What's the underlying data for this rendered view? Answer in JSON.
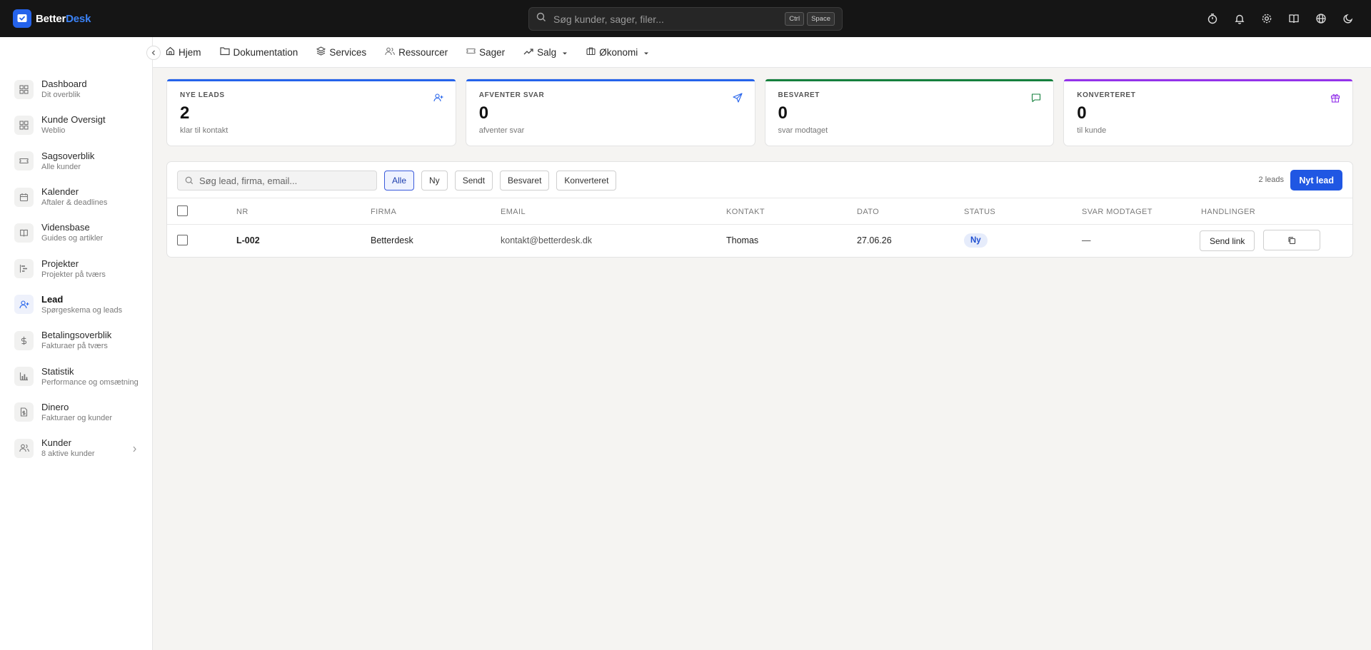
{
  "app": {
    "logo_text_a": "Better",
    "logo_text_b": "Desk",
    "accent_color": "#2563eb"
  },
  "search": {
    "placeholder": "Søg kunder, sager, filer...",
    "shortcut_keys": [
      "Ctrl",
      "Space"
    ]
  },
  "top_icons": [
    "timer-icon",
    "bell-icon",
    "gear-icon",
    "book-icon",
    "globe-icon",
    "moon-icon"
  ],
  "sidebar": {
    "items": [
      {
        "title": "Dashboard",
        "sub": "Dit overblik",
        "icon": "grid-icon"
      },
      {
        "title": "Kunde Oversigt",
        "sub": "Weblio",
        "icon": "grid-icon"
      },
      {
        "title": "Sagsoverblik",
        "sub": "Alle kunder",
        "icon": "ticket-icon"
      },
      {
        "title": "Kalender",
        "sub": "Aftaler & deadlines",
        "icon": "calendar-icon"
      },
      {
        "title": "Vidensbase",
        "sub": "Guides og artikler",
        "icon": "book-icon"
      },
      {
        "title": "Projekter",
        "sub": "Projekter på tværs",
        "icon": "gantt-icon"
      },
      {
        "title": "Lead",
        "sub": "Spørgeskema og leads",
        "icon": "user-plus-icon",
        "active": true
      },
      {
        "title": "Betalingsoverblik",
        "sub": "Fakturaer på tværs",
        "icon": "dollar-icon"
      },
      {
        "title": "Statistik",
        "sub": "Performance og omsætning",
        "icon": "bar-chart-icon"
      },
      {
        "title": "Dinero",
        "sub": "Fakturaer og kunder",
        "icon": "file-dollar-icon"
      },
      {
        "title": "Kunder",
        "sub": "8 aktive kunder",
        "icon": "users-icon"
      }
    ]
  },
  "subnav": {
    "items": [
      {
        "label": "Hjem",
        "icon": "home-icon"
      },
      {
        "label": "Dokumentation",
        "icon": "folder-icon"
      },
      {
        "label": "Services",
        "icon": "layers-icon"
      },
      {
        "label": "Ressourcer",
        "icon": "users-icon"
      },
      {
        "label": "Sager",
        "icon": "ticket-icon"
      },
      {
        "label": "Salg",
        "icon": "trending-up-icon",
        "dropdown": true
      },
      {
        "label": "Økonomi",
        "icon": "briefcase-icon",
        "dropdown": true
      }
    ]
  },
  "stats": [
    {
      "title": "NYE LEADS",
      "value": "2",
      "sub": "klar til kontakt",
      "color": "#2563eb",
      "icon": "user-plus-icon"
    },
    {
      "title": "AFVENTER SVAR",
      "value": "0",
      "sub": "afventer svar",
      "color": "#2563eb",
      "icon": "send-icon"
    },
    {
      "title": "BESVARET",
      "value": "0",
      "sub": "svar modtaget",
      "color": "#15803d",
      "icon": "message-icon"
    },
    {
      "title": "KONVERTERET",
      "value": "0",
      "sub": "til kunde",
      "color": "#9333ea",
      "icon": "gift-icon"
    }
  ],
  "leads": {
    "search_placeholder": "Søg lead, firma, email...",
    "filters": [
      "Alle",
      "Ny",
      "Sendt",
      "Besvaret",
      "Konverteret"
    ],
    "active_filter": "Alle",
    "count_label": "2 leads",
    "new_lead_label": "Nyt lead",
    "columns": [
      "NR",
      "FIRMA",
      "EMAIL",
      "KONTAKT",
      "DATO",
      "STATUS",
      "SVAR MODTAGET",
      "HANDLINGER"
    ],
    "rows": [
      {
        "nr": "L-002",
        "firma": "Betterdesk",
        "email": "kontakt@betterdesk.dk",
        "kontakt": "Thomas",
        "dato": "27.06.26",
        "status": "Ny",
        "svar": "—",
        "action_label": "Send link"
      }
    ]
  }
}
